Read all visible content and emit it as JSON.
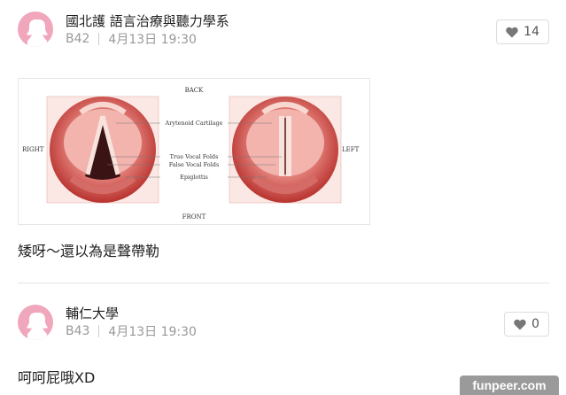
{
  "posts": [
    {
      "author": "國北護 語言治療與聽力學系",
      "floor": "B42",
      "time": "4月13日 19:30",
      "likes": "14",
      "text": "矮呀～還以為是聲帶勒",
      "figure": {
        "back": "BACK",
        "front": "FRONT",
        "right": "RIGHT",
        "left": "LEFT",
        "labels": [
          "Arytenoid Cartilage",
          "True Vocal Folds",
          "False Vocal Folds",
          "Epiglottis"
        ]
      }
    },
    {
      "author": "輔仁大學",
      "floor": "B43",
      "time": "4月13日 19:30",
      "likes": "0",
      "text": "呵呵屁哦XD"
    }
  ],
  "watermark": "funpeer.com",
  "icons": {
    "avatar": "female-silhouette-icon",
    "like": "heart-icon"
  },
  "colors": {
    "avatar": "#f0a6bb",
    "muted": "#999999"
  }
}
